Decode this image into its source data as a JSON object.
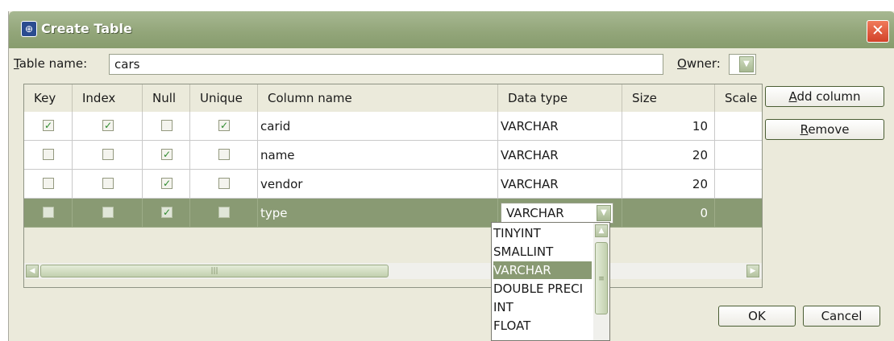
{
  "window": {
    "title": "Create Table",
    "close_label": "✕"
  },
  "form": {
    "table_name_label": "Table name:",
    "table_name_value": "cars",
    "owner_label": "Owner:"
  },
  "columns": [
    "Key",
    "Index",
    "Null",
    "Unique",
    "Column name",
    "Data type",
    "Size",
    "Scale"
  ],
  "rows": [
    {
      "key": true,
      "index": true,
      "null": false,
      "unique": true,
      "name": "carid",
      "type": "VARCHAR",
      "size": "10"
    },
    {
      "key": false,
      "index": false,
      "null": true,
      "unique": false,
      "name": "name",
      "type": "VARCHAR",
      "size": "20"
    },
    {
      "key": false,
      "index": false,
      "null": true,
      "unique": false,
      "name": "vendor",
      "type": "VARCHAR",
      "size": "20"
    },
    {
      "key": false,
      "index": false,
      "null": true,
      "unique": false,
      "name": "type",
      "type": "VARCHAR",
      "size": "0",
      "selected": true
    }
  ],
  "type_dropdown": {
    "options": [
      "TINYINT",
      "SMALLINT",
      "VARCHAR",
      "DOUBLE PRECI",
      "INT",
      "FLOAT"
    ],
    "selected": "VARCHAR"
  },
  "buttons": {
    "add_column": "Add column",
    "remove": "Remove",
    "ok": "OK",
    "cancel": "Cancel"
  },
  "icons": {
    "app": "database-icon",
    "dropdown": "chevron-down-icon",
    "scroll_left": "arrow-left-icon",
    "scroll_right": "arrow-right-icon",
    "scroll_up": "arrow-up-icon"
  },
  "colors": {
    "titlebar": "#93a67a",
    "selection": "#899a73",
    "dialog_bg": "#ebeadb"
  }
}
